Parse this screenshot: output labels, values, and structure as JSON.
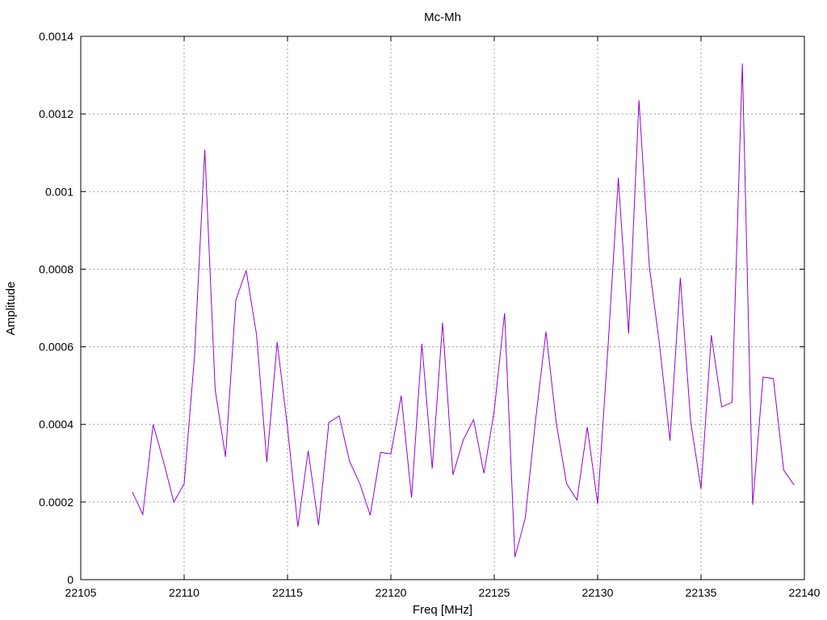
{
  "chart_data": {
    "type": "line",
    "title": "Mc-Mh",
    "xlabel": "Freq [MHz]",
    "ylabel": "Amplitude",
    "xlim": [
      22105,
      22140
    ],
    "ylim": [
      0,
      0.0014
    ],
    "x_ticks": [
      22105,
      22110,
      22115,
      22120,
      22125,
      22130,
      22135,
      22140
    ],
    "x_tick_labels": [
      "22105",
      "22110",
      "22115",
      "22120",
      "22125",
      "22130",
      "22135",
      "22140"
    ],
    "y_ticks": [
      0,
      0.0002,
      0.0004,
      0.0006,
      0.0008,
      0.001,
      0.0012,
      0.0014
    ],
    "y_tick_labels": [
      "0",
      "0.0002",
      "0.0004",
      "0.0006",
      "0.0008",
      "0.001",
      "0.0012",
      "0.0014"
    ],
    "grid": true,
    "legend": "none",
    "series": [
      {
        "color": "#9400d3",
        "x": [
          22107.5,
          22108.0,
          22108.5,
          22109.0,
          22109.5,
          22110.0,
          22110.5,
          22111.0,
          22111.5,
          22112.0,
          22112.5,
          22113.0,
          22113.5,
          22114.0,
          22114.5,
          22115.0,
          22115.5,
          22116.0,
          22116.5,
          22117.0,
          22117.5,
          22118.0,
          22118.5,
          22119.0,
          22119.5,
          22120.0,
          22120.5,
          22121.0,
          22121.5,
          22122.0,
          22122.5,
          22123.0,
          22123.5,
          22124.0,
          22124.5,
          22125.0,
          22125.5,
          22126.0,
          22126.5,
          22127.0,
          22127.5,
          22128.0,
          22128.5,
          22129.0,
          22129.5,
          22130.0,
          22130.5,
          22131.0,
          22131.5,
          22132.0,
          22132.5,
          22133.0,
          22133.5,
          22134.0,
          22134.5,
          22135.0,
          22135.5,
          22136.0,
          22136.5,
          22137.0,
          22137.5,
          22138.0,
          22138.5,
          22139.0,
          22139.5
        ],
        "y": [
          0.000225,
          0.000168,
          0.0004,
          0.000305,
          0.0002,
          0.000247,
          0.000574,
          0.001108,
          0.00049,
          0.000316,
          0.00072,
          0.000797,
          0.000632,
          0.000303,
          0.000612,
          0.000392,
          0.000136,
          0.000332,
          0.00014,
          0.000405,
          0.000422,
          0.000305,
          0.000247,
          0.000166,
          0.000328,
          0.000324,
          0.000474,
          0.000211,
          0.000608,
          0.000286,
          0.000662,
          0.00027,
          0.00036,
          0.000412,
          0.000274,
          0.000436,
          0.000687,
          5.8e-05,
          0.000159,
          0.000412,
          0.000639,
          0.000403,
          0.000247,
          0.000205,
          0.000393,
          0.000195,
          0.000598,
          0.001035,
          0.000634,
          0.001235,
          0.000807,
          0.000603,
          0.000358,
          0.000778,
          0.000407,
          0.000234,
          0.00063,
          0.000445,
          0.000457,
          0.00133,
          0.000193,
          0.000522,
          0.000518,
          0.000282,
          0.000244
        ]
      }
    ]
  }
}
